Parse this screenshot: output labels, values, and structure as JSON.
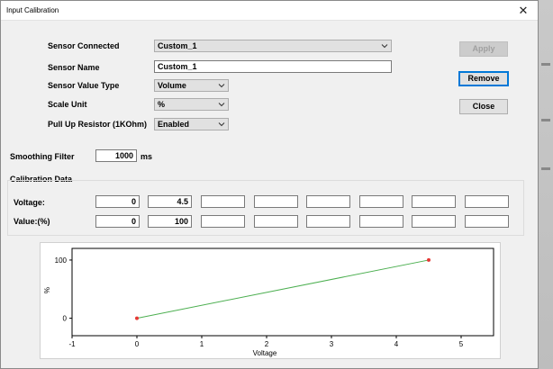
{
  "window": {
    "title": "Input Calibration",
    "close_glyph": "✕"
  },
  "form": {
    "sensor_connected": {
      "label": "Sensor Connected",
      "value": "Custom_1"
    },
    "sensor_name": {
      "label": "Sensor Name",
      "value": "Custom_1"
    },
    "sensor_value_type": {
      "label": "Sensor Value Type",
      "value": "Volume"
    },
    "scale_unit": {
      "label": "Scale Unit",
      "value": "%"
    },
    "pull_up_resistor": {
      "label": "Pull Up Resistor (1KOhm)",
      "value": "Enabled"
    },
    "smoothing_filter": {
      "label": "Smoothing Filter",
      "value": "1000",
      "unit": "ms"
    }
  },
  "buttons": {
    "apply": "Apply",
    "remove": "Remove",
    "close": "Close"
  },
  "calibration": {
    "heading": "Calibration Data",
    "voltage_label": "Voltage:",
    "value_label": "Value:(%)",
    "voltage_values": [
      "0",
      "4.5",
      "",
      "",
      "",
      "",
      "",
      ""
    ],
    "value_values": [
      "0",
      "100",
      "",
      "",
      "",
      "",
      "",
      ""
    ]
  },
  "chart_data": {
    "type": "line",
    "xlabel": "Voltage",
    "ylabel": "%",
    "xlim": [
      -1,
      5.5
    ],
    "ylim": [
      -30,
      120
    ],
    "x_ticks": [
      "-1",
      "0",
      "1",
      "2",
      "3",
      "4",
      "5"
    ],
    "y_ticks": [
      "0",
      "100"
    ],
    "grid": false,
    "series": [
      {
        "x": [
          0,
          4.5
        ],
        "y": [
          0,
          100
        ],
        "line_color": "#4caf50",
        "marker_color": "#e53935"
      }
    ]
  }
}
